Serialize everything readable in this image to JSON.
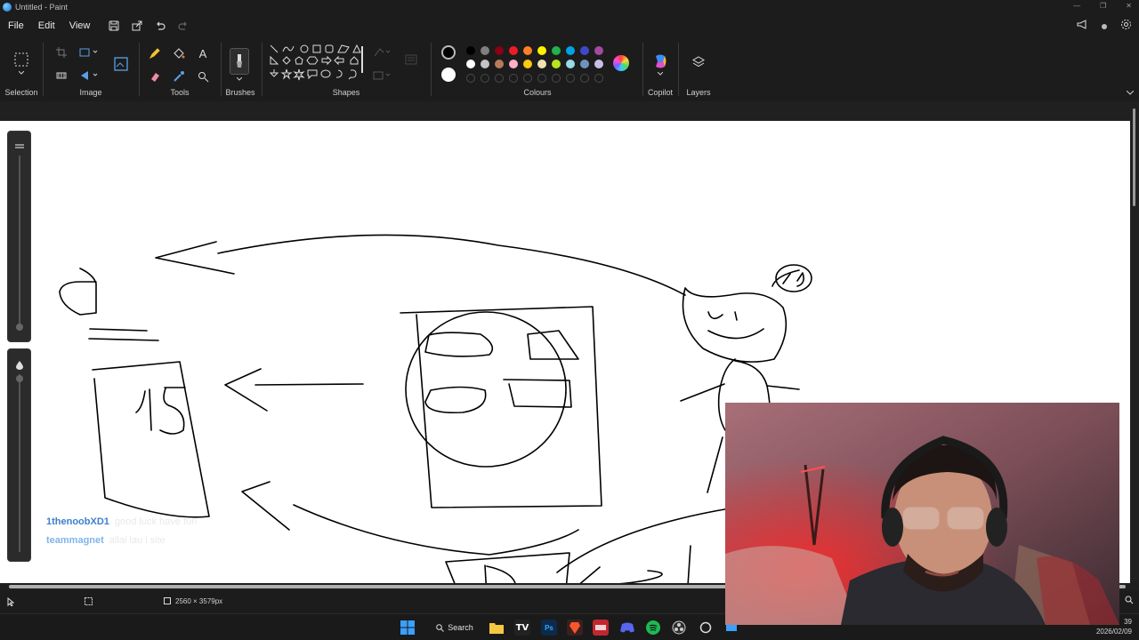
{
  "window": {
    "title": "Untitled - Paint"
  },
  "menu": {
    "file": "File",
    "edit": "Edit",
    "view": "View"
  },
  "ribbon": {
    "selection": "Selection",
    "image": "Image",
    "tools": "Tools",
    "brushes": "Brushes",
    "shapes": "Shapes",
    "colours": "Colours",
    "copilot": "Copilot",
    "layers": "Layers"
  },
  "palette": {
    "primary": "#000000",
    "secondary": "#ffffff",
    "row1": [
      "#000000",
      "#7f7f7f",
      "#880015",
      "#ed1c24",
      "#ff7f27",
      "#fff200",
      "#22b14c",
      "#00a2e8",
      "#3f48cc",
      "#a349a4"
    ],
    "row2": [
      "#ffffff",
      "#c3c3c3",
      "#b97a57",
      "#ffaec9",
      "#ffc90e",
      "#efe4b0",
      "#b5e61d",
      "#99d9ea",
      "#7092be",
      "#c8bfe7"
    ]
  },
  "chat": [
    {
      "user": "1thenoobXD1",
      "message": "good luck have fun"
    },
    {
      "user": "teammagnet",
      "message": "allai lau l site"
    }
  ],
  "status": {
    "canvas_size": "2560 × 3579px"
  },
  "taskbar": {
    "search_label": "Search",
    "time": "39",
    "date": "2026/02/09"
  }
}
